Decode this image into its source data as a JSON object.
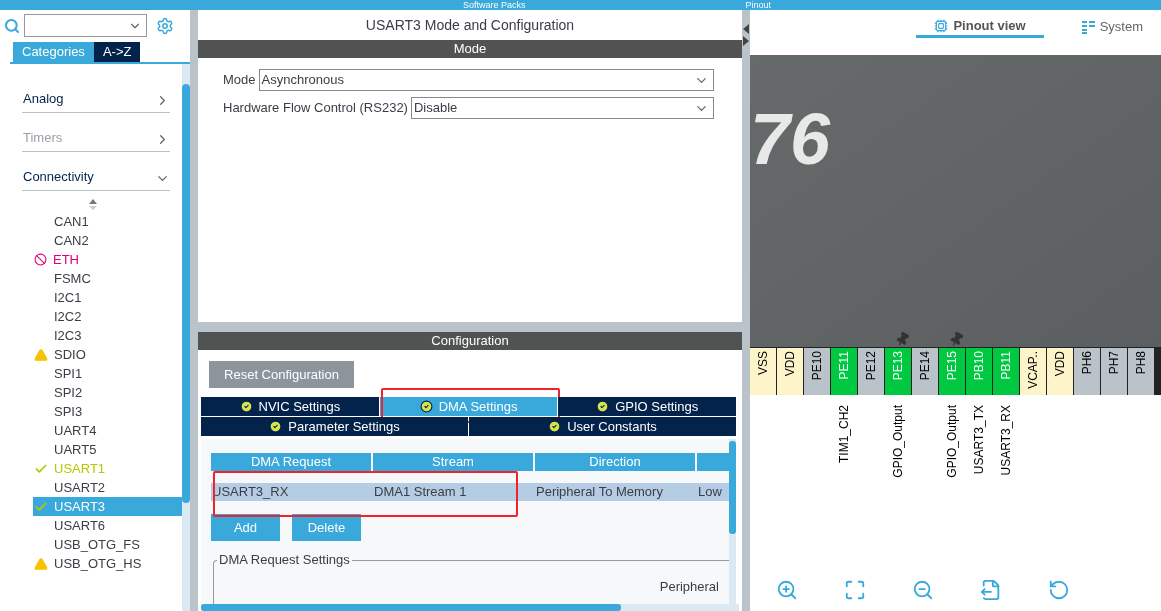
{
  "top_bar": {
    "items": [
      "Software Packs",
      "Pinout"
    ]
  },
  "sidebar": {
    "tabs": [
      {
        "label": "Categories",
        "selected": true
      },
      {
        "label": "A->Z",
        "selected": false
      }
    ],
    "categories": [
      {
        "label": "Analog",
        "expanded": false,
        "disabled": false
      },
      {
        "label": "Timers",
        "expanded": false,
        "disabled": true
      },
      {
        "label": "Connectivity",
        "expanded": true,
        "disabled": false
      }
    ],
    "items": [
      {
        "label": "CAN1",
        "configured": false,
        "warning": false,
        "blocked": false,
        "selected": false
      },
      {
        "label": "CAN2",
        "configured": false,
        "warning": false,
        "blocked": false,
        "selected": false
      },
      {
        "label": "ETH",
        "configured": false,
        "warning": false,
        "blocked": true,
        "selected": false
      },
      {
        "label": "FSMC",
        "configured": false,
        "warning": false,
        "blocked": false,
        "selected": false
      },
      {
        "label": "I2C1",
        "configured": false,
        "warning": false,
        "blocked": false,
        "selected": false
      },
      {
        "label": "I2C2",
        "configured": false,
        "warning": false,
        "blocked": false,
        "selected": false
      },
      {
        "label": "I2C3",
        "configured": false,
        "warning": false,
        "blocked": false,
        "selected": false
      },
      {
        "label": "SDIO",
        "configured": false,
        "warning": true,
        "blocked": false,
        "selected": false
      },
      {
        "label": "SPI1",
        "configured": false,
        "warning": false,
        "blocked": false,
        "selected": false
      },
      {
        "label": "SPI2",
        "configured": false,
        "warning": false,
        "blocked": false,
        "selected": false
      },
      {
        "label": "SPI3",
        "configured": false,
        "warning": false,
        "blocked": false,
        "selected": false
      },
      {
        "label": "UART4",
        "configured": false,
        "warning": false,
        "blocked": false,
        "selected": false
      },
      {
        "label": "UART5",
        "configured": false,
        "warning": false,
        "blocked": false,
        "selected": false
      },
      {
        "label": "USART1",
        "configured": true,
        "warning": false,
        "blocked": false,
        "selected": false
      },
      {
        "label": "USART2",
        "configured": false,
        "warning": false,
        "blocked": false,
        "selected": false
      },
      {
        "label": "USART3",
        "configured": true,
        "warning": false,
        "blocked": false,
        "selected": true
      },
      {
        "label": "USART6",
        "configured": false,
        "warning": false,
        "blocked": false,
        "selected": false
      },
      {
        "label": "USB_OTG_FS",
        "configured": false,
        "warning": false,
        "blocked": false,
        "selected": false
      },
      {
        "label": "USB_OTG_HS",
        "configured": false,
        "warning": true,
        "blocked": false,
        "selected": false
      }
    ]
  },
  "panel": {
    "title": "USART3 Mode and Configuration",
    "mode_header": "Mode",
    "fields": [
      {
        "label": "Mode",
        "value": "Asynchronous"
      },
      {
        "label": "Hardware Flow Control (RS232)",
        "value": "Disable"
      }
    ],
    "config_header": "Configuration",
    "reset_button": "Reset Configuration",
    "tab_rows": [
      [
        {
          "label": "NVIC Settings",
          "selected": false,
          "highlighted": false
        },
        {
          "label": "DMA Settings",
          "selected": true,
          "highlighted": true
        },
        {
          "label": "GPIO Settings",
          "selected": false,
          "highlighted": false
        }
      ],
      [
        {
          "label": "Parameter Settings",
          "selected": false,
          "highlighted": false
        },
        {
          "label": "User Constants",
          "selected": false,
          "highlighted": false
        }
      ]
    ],
    "table": {
      "columns": [
        "DMA Request",
        "Stream",
        "Direction"
      ],
      "rows": [
        {
          "cells": [
            "USART3_RX",
            "DMA1 Stream 1",
            "Peripheral To Memory",
            "Low"
          ],
          "highlighted": true
        }
      ]
    },
    "buttons": [
      "Add",
      "Delete"
    ],
    "settings_legend": "DMA Request Settings",
    "settings_text": "Peripheral"
  },
  "pinout": {
    "tabs": [
      {
        "label": "Pinout view",
        "selected": true
      },
      {
        "label": "System",
        "selected": false
      }
    ],
    "chip_text": "76",
    "pins": [
      {
        "name": "VSS",
        "power": true,
        "assigned": false,
        "pinned": false
      },
      {
        "name": "VDD",
        "power": true,
        "assigned": false,
        "pinned": false
      },
      {
        "name": "PE10",
        "power": false,
        "assigned": false,
        "pinned": false
      },
      {
        "name": "PE11",
        "power": false,
        "assigned": true,
        "pinned": false,
        "signal": "TIM1_CH2"
      },
      {
        "name": "PE12",
        "power": false,
        "assigned": false,
        "pinned": false
      },
      {
        "name": "PE13",
        "power": false,
        "assigned": true,
        "pinned": true,
        "signal": "GPIO_Output"
      },
      {
        "name": "PE14",
        "power": false,
        "assigned": false,
        "pinned": false
      },
      {
        "name": "PE15",
        "power": false,
        "assigned": true,
        "pinned": true,
        "signal": "GPIO_Output"
      },
      {
        "name": "PB10",
        "power": false,
        "assigned": true,
        "pinned": false,
        "signal": "USART3_TX"
      },
      {
        "name": "PB11",
        "power": false,
        "assigned": true,
        "pinned": false,
        "signal": "USART3_RX"
      },
      {
        "name": "VCAP..",
        "power": true,
        "assigned": false,
        "pinned": false
      },
      {
        "name": "VDD",
        "power": true,
        "assigned": false,
        "pinned": false
      },
      {
        "name": "PH6",
        "power": false,
        "assigned": false,
        "pinned": false
      },
      {
        "name": "PH7",
        "power": false,
        "assigned": false,
        "pinned": false
      },
      {
        "name": "PH8",
        "power": false,
        "assigned": false,
        "pinned": false
      }
    ]
  }
}
